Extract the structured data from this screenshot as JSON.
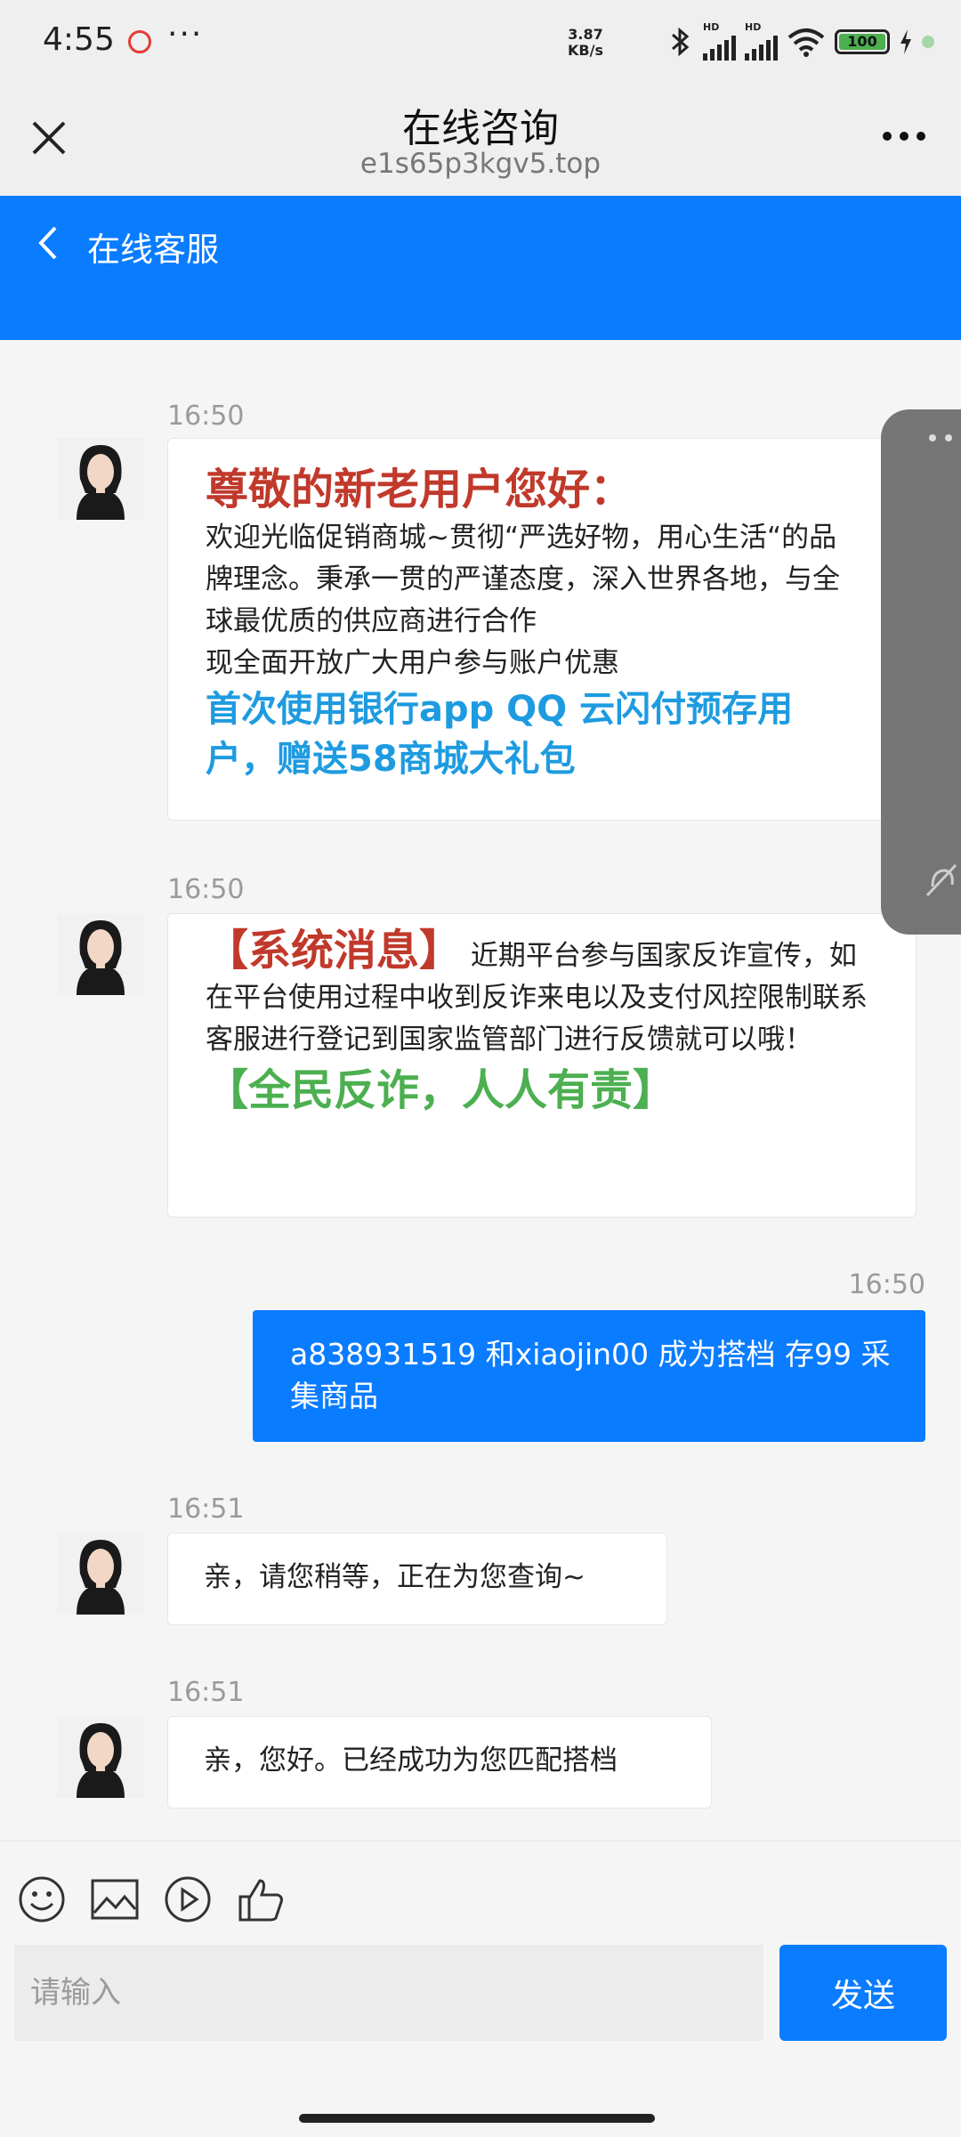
{
  "status_bar": {
    "time": "4:55",
    "dots": "···",
    "net_speed_value": "3.87",
    "net_speed_unit": "KB/s",
    "signal_label": "HD",
    "battery": "100"
  },
  "browser": {
    "title": "在线咨询",
    "url": "e1s65p3kgv5.top"
  },
  "chat_header": {
    "title": "在线客服"
  },
  "messages": [
    {
      "time": "16:50",
      "title": "尊敬的新老用户您好：",
      "body": "欢迎光临促销商城~贯彻“严选好物，用心生活“的品牌理念。秉承一贯的严谨态度，深入世界各地，与全球最优质的供应商进行合作",
      "body2": "现全面开放广大用户参与账户优惠",
      "highlight": "首次使用银行app QQ 云闪付预存用户，赠送58商城大礼包"
    },
    {
      "time": "16:50",
      "tag": "【系统消息】",
      "body": "近期平台参与国家反诈宣传，如在平台使用过程中收到反诈来电以及支付风控限制联系客服进行登记到国家监管部门进行反馈就可以哦！",
      "slogan": "【全民反诈，人人有责】"
    },
    {
      "time": "16:50",
      "text": "a838931519 和xiaojin00 成为搭档 存99 采集商品"
    },
    {
      "time": "16:51",
      "text": "亲，请您稍等，正在为您查询~"
    },
    {
      "time": "16:51",
      "text": "亲，您好。已经成功为您匹配搭档"
    }
  ],
  "input": {
    "placeholder": "请输入",
    "send_label": "发送"
  }
}
